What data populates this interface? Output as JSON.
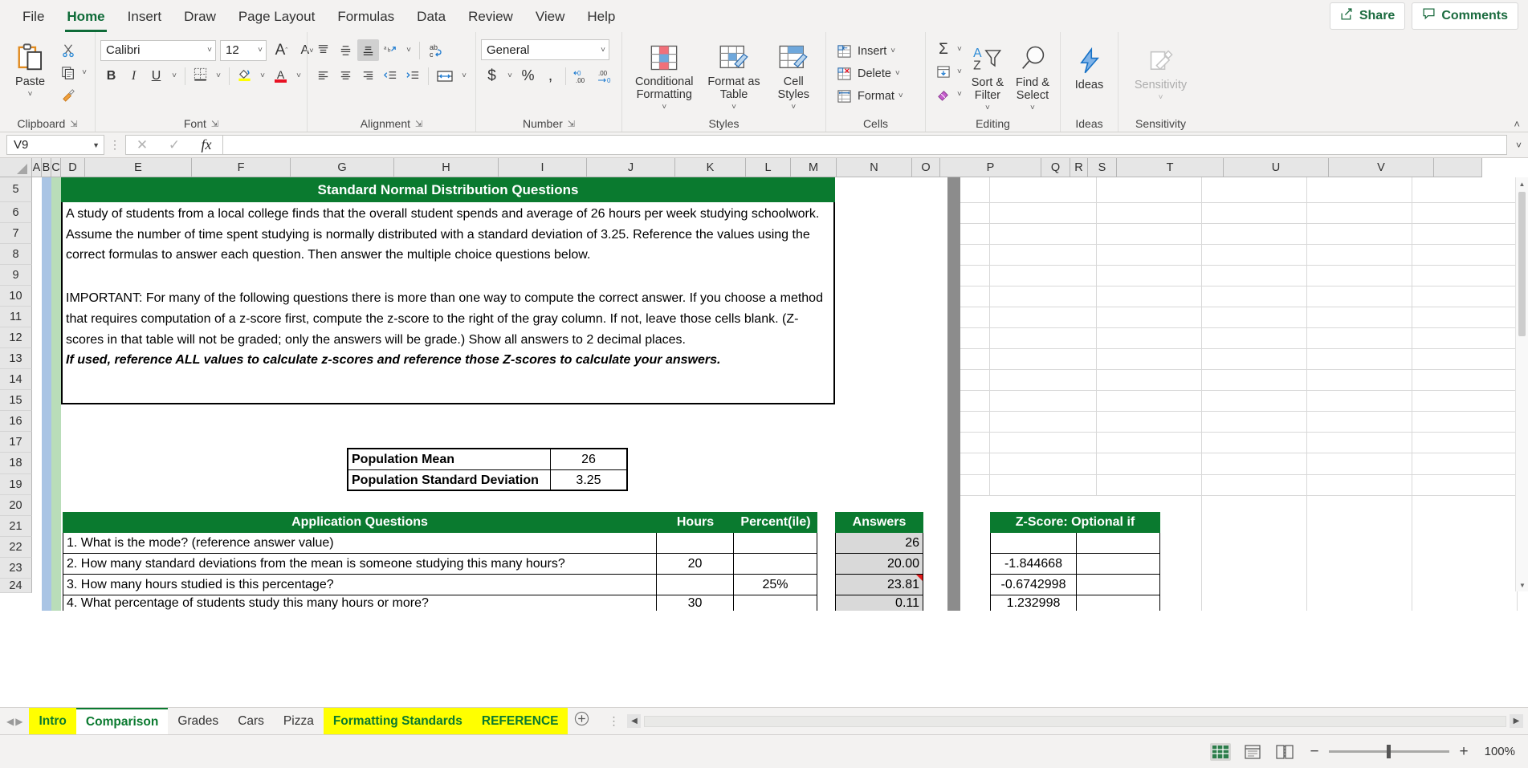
{
  "ribbon": {
    "tabs": [
      {
        "label": "File",
        "active": false
      },
      {
        "label": "Home",
        "active": true
      },
      {
        "label": "Insert",
        "active": false
      },
      {
        "label": "Draw",
        "active": false
      },
      {
        "label": "Page Layout",
        "active": false
      },
      {
        "label": "Formulas",
        "active": false
      },
      {
        "label": "Data",
        "active": false
      },
      {
        "label": "Review",
        "active": false
      },
      {
        "label": "View",
        "active": false
      },
      {
        "label": "Help",
        "active": false
      }
    ],
    "share_label": "Share",
    "comments_label": "Comments",
    "groups": {
      "clipboard": {
        "label": "Clipboard",
        "paste": "Paste",
        "cut": "cut-icon",
        "copy": "copy-icon",
        "format_painter": "format-painter-icon"
      },
      "font": {
        "label": "Font",
        "font_name": "Calibri",
        "font_size": "12",
        "grow": "A",
        "shrink": "A",
        "bold": "B",
        "italic": "I",
        "underline": "U",
        "borders": "borders-icon",
        "fill_color": "fill-color-icon",
        "font_color": "A"
      },
      "alignment": {
        "label": "Alignment",
        "top_align": "top-align-icon",
        "middle_align": "middle-align-icon",
        "bottom_align": "bottom-align-icon",
        "orientation": "orientation-icon",
        "wrap_text": "wrap-text-icon",
        "align_left": "align-left-icon",
        "align_center": "align-center-icon",
        "align_right": "align-right-icon",
        "decrease_indent": "decrease-indent-icon",
        "increase_indent": "increase-indent-icon",
        "merge_center": "merge-center-icon"
      },
      "number": {
        "label": "Number",
        "format": "General",
        "accounting": "$",
        "percent": "%",
        "comma": ",",
        "increase_decimal": ".00",
        "decrease_decimal": ".00"
      },
      "styles": {
        "label": "Styles",
        "conditional_formatting": "Conditional Formatting",
        "format_as_table": "Format as Table",
        "cell_styles": "Cell Styles"
      },
      "cells": {
        "label": "Cells",
        "insert": "Insert",
        "delete": "Delete",
        "format": "Format"
      },
      "editing": {
        "label": "Editing",
        "autosum": "autosum-icon",
        "fill": "fill-icon",
        "clear": "clear-icon",
        "sort_filter": "Sort & Filter",
        "find_select": "Find & Select"
      },
      "ideas": {
        "label": "Ideas",
        "button": "Ideas"
      },
      "sensitivity": {
        "label": "Sensitivity",
        "button": "Sensitivity"
      }
    }
  },
  "formula_bar": {
    "name_box": "V9",
    "formula": "",
    "cancel": "cancel-icon",
    "enter": "enter-icon",
    "insert_function": "fx"
  },
  "grid": {
    "columns": [
      "A",
      "B",
      "C",
      "D",
      "E",
      "F",
      "G",
      "H",
      "I",
      "J",
      "K",
      "L",
      "M",
      "N",
      "O",
      "P",
      "Q",
      "R",
      "S",
      "T",
      "U",
      "V"
    ],
    "rows": [
      "5",
      "6",
      "7",
      "8",
      "9",
      "10",
      "11",
      "12",
      "13",
      "14",
      "15",
      "16",
      "17",
      "18",
      "19",
      "20",
      "21",
      "22",
      "23",
      "24"
    ],
    "title_banner": "Standard Normal Distribution Questions",
    "intro_paragraph_1": "A study of students from a local college finds that the overall student spends and average of 26 hours per week studying schoolwork. Assume the number of time spent studying is normally distributed with a standard deviation of 3.25. Reference the values using the correct formulas to answer each question. Then answer the multiple choice questions below.",
    "intro_paragraph_2": "IMPORTANT: For many of the following questions there is more than one way to compute the correct answer. If you choose a method that requires computation of a z-score first, compute the z-score to the right of the gray column. If not, leave those cells blank. (Z-scores in that table will not be graded; only the answers will be grade.)  Show all answers to 2 decimal places.",
    "intro_paragraph_3": "If used, reference ALL values to calculate z-scores and reference those Z-scores to calculate your answers.",
    "params_table": [
      {
        "label": "Population Mean",
        "value": "26"
      },
      {
        "label": "Population Standard Deviation",
        "value": "3.25"
      }
    ],
    "questions_table": {
      "headers": [
        "Application Questions",
        "Hours",
        "Percent(ile)",
        "Answers"
      ],
      "rows": [
        {
          "q": "1.  What is the mode? (reference answer value)",
          "hours": "",
          "pct": "",
          "answer": "26",
          "comment": false
        },
        {
          "q": "2.  How many standard deviations from the mean is someone studying this many hours?",
          "hours": "20",
          "pct": "",
          "answer": "20.00",
          "comment": false
        },
        {
          "q": "3.  How many hours studied is this percentage?",
          "hours": "",
          "pct": "25%",
          "answer": "23.81",
          "comment": true
        },
        {
          "q": "4.  What percentage of students study this many hours or more?",
          "hours": "30",
          "pct": "",
          "answer": "0.11",
          "comment": false
        }
      ]
    },
    "zscore_table": {
      "header": "Z-Score: Optional if",
      "values": [
        "",
        "-1.844668",
        "-0.6742998",
        "1.232998"
      ]
    },
    "accent_green": "#0a7a2f",
    "gray_fill": "#d9d9d9"
  },
  "sheet_tabs": {
    "items": [
      {
        "label": "Intro",
        "style": "yellow"
      },
      {
        "label": "Comparison",
        "style": "active"
      },
      {
        "label": "Grades",
        "style": "normal"
      },
      {
        "label": "Cars",
        "style": "normal"
      },
      {
        "label": "Pizza",
        "style": "normal"
      },
      {
        "label": "Formatting Standards",
        "style": "yellow"
      },
      {
        "label": "REFERENCE",
        "style": "yellow"
      }
    ],
    "add_sheet": "+",
    "nav_first": "◀",
    "nav_prev": "◀",
    "nav_next": "▶",
    "nav_last": "▶"
  },
  "status_bar": {
    "normal_view": "normal-view-icon",
    "page_layout_view": "page-layout-view-icon",
    "page_break_view": "page-break-view-icon",
    "zoom_out": "−",
    "zoom_in": "+",
    "zoom_level": "100%"
  }
}
